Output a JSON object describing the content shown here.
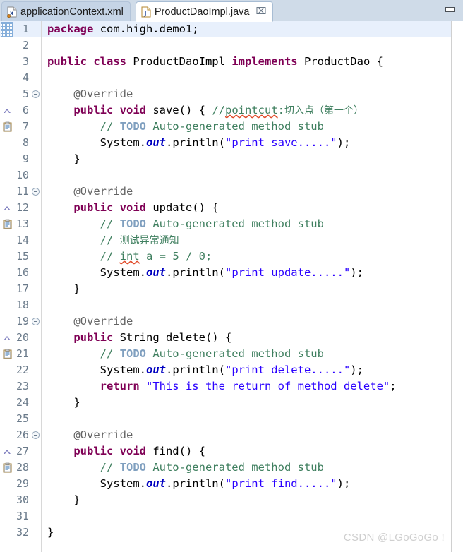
{
  "window": {
    "minimize_label": "Minimize"
  },
  "tabs": [
    {
      "label": "applicationContext.xml",
      "icon": "xml-file-icon",
      "active": false,
      "closable": false
    },
    {
      "label": "ProductDaoImpl.java",
      "icon": "java-file-icon",
      "active": true,
      "closable": true,
      "close_glyph": "⌧"
    }
  ],
  "editor": {
    "current_line": 1,
    "lines": [
      {
        "n": 1,
        "marker": "changed-hatch",
        "fold": false,
        "segments": [
          {
            "t": "package ",
            "c": "kw"
          },
          {
            "t": "com.high.demo1;",
            "c": "pln"
          }
        ]
      },
      {
        "n": 2,
        "marker": "",
        "fold": false,
        "segments": []
      },
      {
        "n": 3,
        "marker": "",
        "fold": false,
        "segments": [
          {
            "t": "public class ",
            "c": "kw"
          },
          {
            "t": "ProductDaoImpl ",
            "c": "pln"
          },
          {
            "t": "implements ",
            "c": "kw"
          },
          {
            "t": "ProductDao {",
            "c": "pln"
          }
        ]
      },
      {
        "n": 4,
        "marker": "",
        "fold": false,
        "segments": []
      },
      {
        "n": 5,
        "marker": "",
        "fold": true,
        "segments": [
          {
            "t": "    @Override",
            "c": "ann"
          }
        ]
      },
      {
        "n": 6,
        "marker": "override-arrow",
        "fold": false,
        "segments": [
          {
            "t": "    ",
            "c": "pln"
          },
          {
            "t": "public void ",
            "c": "kw"
          },
          {
            "t": "save() { ",
            "c": "pln"
          },
          {
            "t": "//",
            "c": "cmt"
          },
          {
            "t": "pointcut",
            "c": "cmt sq"
          },
          {
            "t": ":",
            "c": "cmt"
          },
          {
            "t": "切入点（第一个）",
            "c": "cmt cjk"
          }
        ]
      },
      {
        "n": 7,
        "marker": "todo-task",
        "fold": false,
        "segments": [
          {
            "t": "        // ",
            "c": "cmt"
          },
          {
            "t": "TODO",
            "c": "todo"
          },
          {
            "t": " Auto-generated method stub",
            "c": "cmt"
          }
        ]
      },
      {
        "n": 8,
        "marker": "",
        "fold": false,
        "segments": [
          {
            "t": "        System.",
            "c": "pln"
          },
          {
            "t": "out",
            "c": "fld"
          },
          {
            "t": ".println(",
            "c": "pln"
          },
          {
            "t": "\"print save.....\"",
            "c": "str"
          },
          {
            "t": ");",
            "c": "pln"
          }
        ]
      },
      {
        "n": 9,
        "marker": "",
        "fold": false,
        "segments": [
          {
            "t": "    }",
            "c": "pln"
          }
        ]
      },
      {
        "n": 10,
        "marker": "",
        "fold": false,
        "segments": []
      },
      {
        "n": 11,
        "marker": "",
        "fold": true,
        "segments": [
          {
            "t": "    @Override",
            "c": "ann"
          }
        ]
      },
      {
        "n": 12,
        "marker": "override-arrow",
        "fold": false,
        "segments": [
          {
            "t": "    ",
            "c": "pln"
          },
          {
            "t": "public void ",
            "c": "kw"
          },
          {
            "t": "update() {",
            "c": "pln"
          }
        ]
      },
      {
        "n": 13,
        "marker": "todo-task",
        "fold": false,
        "segments": [
          {
            "t": "        // ",
            "c": "cmt"
          },
          {
            "t": "TODO",
            "c": "todo"
          },
          {
            "t": " Auto-generated method stub",
            "c": "cmt"
          }
        ]
      },
      {
        "n": 14,
        "marker": "",
        "fold": false,
        "segments": [
          {
            "t": "        // ",
            "c": "cmt"
          },
          {
            "t": "测试异常通知",
            "c": "cmt cjk"
          }
        ]
      },
      {
        "n": 15,
        "marker": "",
        "fold": false,
        "segments": [
          {
            "t": "        // ",
            "c": "cmt"
          },
          {
            "t": "int",
            "c": "cmt sq"
          },
          {
            "t": " a = 5 / 0;",
            "c": "cmt"
          }
        ]
      },
      {
        "n": 16,
        "marker": "",
        "fold": false,
        "segments": [
          {
            "t": "        System.",
            "c": "pln"
          },
          {
            "t": "out",
            "c": "fld"
          },
          {
            "t": ".println(",
            "c": "pln"
          },
          {
            "t": "\"print update.....\"",
            "c": "str"
          },
          {
            "t": ");",
            "c": "pln"
          }
        ]
      },
      {
        "n": 17,
        "marker": "",
        "fold": false,
        "segments": [
          {
            "t": "    }",
            "c": "pln"
          }
        ]
      },
      {
        "n": 18,
        "marker": "",
        "fold": false,
        "segments": []
      },
      {
        "n": 19,
        "marker": "",
        "fold": true,
        "segments": [
          {
            "t": "    @Override",
            "c": "ann"
          }
        ]
      },
      {
        "n": 20,
        "marker": "override-arrow",
        "fold": false,
        "segments": [
          {
            "t": "    ",
            "c": "pln"
          },
          {
            "t": "public ",
            "c": "kw"
          },
          {
            "t": "String delete() {",
            "c": "pln"
          }
        ]
      },
      {
        "n": 21,
        "marker": "todo-task",
        "fold": false,
        "segments": [
          {
            "t": "        // ",
            "c": "cmt"
          },
          {
            "t": "TODO",
            "c": "todo"
          },
          {
            "t": " Auto-generated method stub",
            "c": "cmt"
          }
        ]
      },
      {
        "n": 22,
        "marker": "",
        "fold": false,
        "segments": [
          {
            "t": "        System.",
            "c": "pln"
          },
          {
            "t": "out",
            "c": "fld"
          },
          {
            "t": ".println(",
            "c": "pln"
          },
          {
            "t": "\"print delete.....\"",
            "c": "str"
          },
          {
            "t": ");",
            "c": "pln"
          }
        ]
      },
      {
        "n": 23,
        "marker": "",
        "fold": false,
        "segments": [
          {
            "t": "        ",
            "c": "pln"
          },
          {
            "t": "return ",
            "c": "kw"
          },
          {
            "t": "\"This is the return of method delete\"",
            "c": "str"
          },
          {
            "t": ";",
            "c": "pln"
          }
        ]
      },
      {
        "n": 24,
        "marker": "",
        "fold": false,
        "segments": [
          {
            "t": "    }",
            "c": "pln"
          }
        ]
      },
      {
        "n": 25,
        "marker": "",
        "fold": false,
        "segments": []
      },
      {
        "n": 26,
        "marker": "",
        "fold": true,
        "segments": [
          {
            "t": "    @Override",
            "c": "ann"
          }
        ]
      },
      {
        "n": 27,
        "marker": "override-arrow",
        "fold": false,
        "segments": [
          {
            "t": "    ",
            "c": "pln"
          },
          {
            "t": "public void ",
            "c": "kw"
          },
          {
            "t": "find() {",
            "c": "pln"
          }
        ]
      },
      {
        "n": 28,
        "marker": "todo-task",
        "fold": false,
        "segments": [
          {
            "t": "        // ",
            "c": "cmt"
          },
          {
            "t": "TODO",
            "c": "todo"
          },
          {
            "t": " Auto-generated method stub",
            "c": "cmt"
          }
        ]
      },
      {
        "n": 29,
        "marker": "",
        "fold": false,
        "segments": [
          {
            "t": "        System.",
            "c": "pln"
          },
          {
            "t": "out",
            "c": "fld"
          },
          {
            "t": ".println(",
            "c": "pln"
          },
          {
            "t": "\"print find.....\"",
            "c": "str"
          },
          {
            "t": ");",
            "c": "pln"
          }
        ]
      },
      {
        "n": 30,
        "marker": "",
        "fold": false,
        "segments": [
          {
            "t": "    }",
            "c": "pln"
          }
        ]
      },
      {
        "n": 31,
        "marker": "",
        "fold": false,
        "segments": []
      },
      {
        "n": 32,
        "marker": "",
        "fold": false,
        "segments": [
          {
            "t": "}",
            "c": "pln"
          }
        ]
      }
    ]
  },
  "watermark": {
    "text": "CSDN @LGoGoGo !"
  },
  "colors": {
    "keyword": "#7f0055",
    "string": "#2a00ff",
    "comment": "#3f7f5f",
    "todo": "#7f9fbf",
    "annotation": "#646464",
    "field": "#0000c0",
    "current_line_bg": "#e8f0fc",
    "tabbar_bg": "#cfdbe8",
    "tab_inactive_bg": "#c5d4e6",
    "tab_active_bg": "#ffffff",
    "linenumber": "#6a7a8a",
    "error_squiggle": "#e04b2a"
  }
}
